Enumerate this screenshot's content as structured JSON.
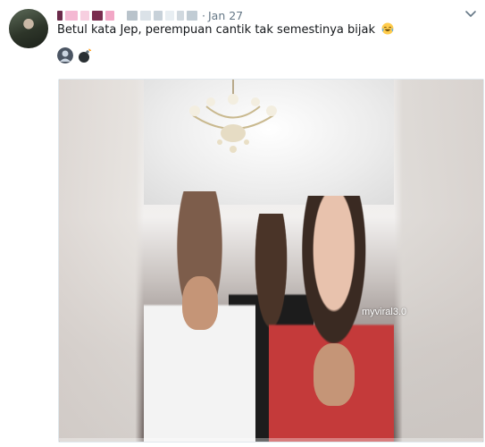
{
  "tweet": {
    "date": "Jan 27",
    "separator": "·",
    "text": "Betul kata Jep, perempuan cantik tak semestinya bijak",
    "text_emoji": "face-with-tears-of-joy-icon",
    "reply_emojis": [
      "person-avatar-emoji",
      "bomb-emoji"
    ]
  },
  "media": {
    "video_label": "myviral3.0",
    "watermark": "",
    "playback_progress": 0.0
  },
  "colors": {
    "text": "#14171a",
    "muted": "#657786",
    "border": "#e1e8ed",
    "name_blur_pink": "#f4b9d3",
    "name_blur_dark": "#6b2a4a"
  }
}
